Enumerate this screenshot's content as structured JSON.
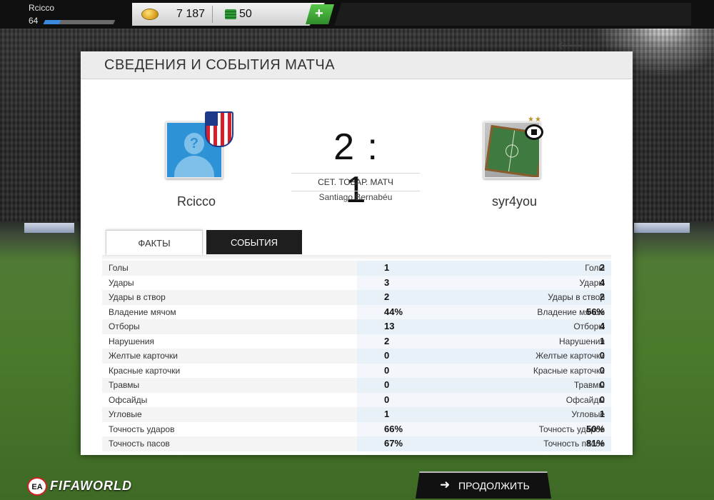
{
  "player": {
    "name": "Rcicco",
    "level": "64",
    "xp_progress": 0.22
  },
  "wallet": {
    "coins": "7 187",
    "points": "50",
    "add_label": "+"
  },
  "panel": {
    "title": "СВЕДЕНИЯ И СОБЫТИЯ МАТЧА"
  },
  "match": {
    "home_name": "Rcicco",
    "away_name": "syr4you",
    "score": "2 : 1",
    "type": "СЕТ. ТОВАР. МАТЧ",
    "venue": "Santiago Bernabéu",
    "away_stars": "★★"
  },
  "tabs": {
    "facts": "ФАКТЫ",
    "events": "СОБЫТИЯ"
  },
  "stats": [
    {
      "label": "Голы",
      "home": "2",
      "away": "1"
    },
    {
      "label": "Удары",
      "home": "4",
      "away": "3"
    },
    {
      "label": "Удары в створ",
      "home": "2",
      "away": "2"
    },
    {
      "label": "Владение мячом",
      "home": "56%",
      "away": "44%"
    },
    {
      "label": "Отборы",
      "home": "4",
      "away": "13"
    },
    {
      "label": "Нарушения",
      "home": "1",
      "away": "2"
    },
    {
      "label": "Желтые карточки",
      "home": "0",
      "away": "0"
    },
    {
      "label": "Красные карточки",
      "home": "0",
      "away": "0"
    },
    {
      "label": "Травмы",
      "home": "0",
      "away": "0"
    },
    {
      "label": "Офсайды",
      "home": "0",
      "away": "0"
    },
    {
      "label": "Угловые",
      "home": "1",
      "away": "1"
    },
    {
      "label": "Точность ударов",
      "home": "50%",
      "away": "66%"
    },
    {
      "label": "Точность пасов",
      "home": "81%",
      "away": "67%"
    }
  ],
  "footer": {
    "continue_label": "ПРОДОЛЖИТЬ",
    "continue_arrow": "➜",
    "ea_logo": "EA",
    "fifa_logo": "FIFAWORLD"
  },
  "colors": {
    "accent_blue": "#2d93d6",
    "plus_green": "#3fae38",
    "dark": "#111111"
  }
}
